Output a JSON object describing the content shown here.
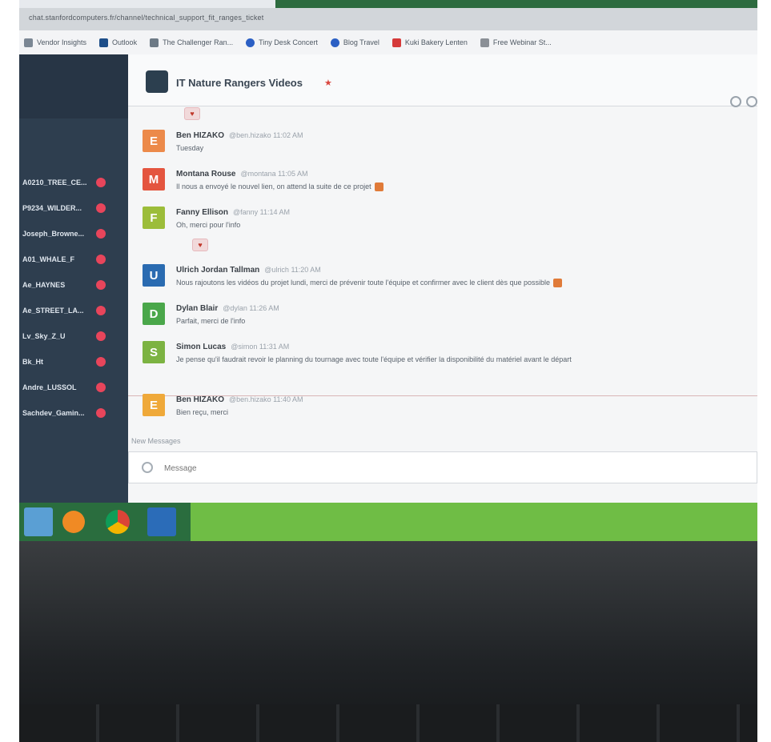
{
  "browser": {
    "url": "chat.stanfordcomputers.fr/channel/technical_support_fit_ranges_ticket"
  },
  "bookmarks": [
    {
      "label": "Vendor Insights",
      "color": "#7b8794"
    },
    {
      "label": "Outlook",
      "color": "#1d4e89"
    },
    {
      "label": "The Challenger Ran...",
      "color": "#6d7a86"
    },
    {
      "label": "Tiny Desk Concert",
      "color": "#2b5fc4"
    },
    {
      "label": "Blog Travel",
      "color": "#2b5fc4"
    },
    {
      "label": "Kuki Bakery Lenten",
      "color": "#d53a3a"
    },
    {
      "label": "Free Webinar St...",
      "color": "#8a8f96"
    }
  ],
  "sidebar": {
    "items": [
      {
        "label": "A0210_TREE_CE..."
      },
      {
        "label": "P9234_WILDER..."
      },
      {
        "label": "Joseph_Browne..."
      },
      {
        "label": "A01_WHALE_F"
      },
      {
        "label": "Ae_HAYNES"
      },
      {
        "label": "Ae_STREET_LA..."
      },
      {
        "label": "Lv_Sky_Z_U"
      },
      {
        "label": "Bk_Ht"
      },
      {
        "label": "Andre_LUSSOL"
      },
      {
        "label": "Sachdev_Gamin..."
      }
    ]
  },
  "channel": {
    "title": "IT Nature Rangers Videos",
    "star": "★"
  },
  "messages": [
    {
      "initial": "E",
      "color": "#ec8a4a",
      "author": "Ben HIZAKO",
      "meta": "@ben.hizako 11:02 AM",
      "text": "Tuesday"
    },
    {
      "initial": "M",
      "color": "#e4553f",
      "author": "Montana Rouse",
      "meta": "@montana 11:05 AM",
      "text": "Il nous a envoyé le nouvel lien, on attend la suite de ce projet"
    },
    {
      "initial": "F",
      "color": "#9cbd3a",
      "author": "Fanny Ellison",
      "meta": "@fanny 11:14 AM",
      "text": "Oh, merci pour l'info"
    },
    {
      "initial": "U",
      "color": "#2a6bb1",
      "author": "Ulrich Jordan Tallman",
      "meta": "@ulrich 11:20 AM",
      "text": "Nous rajoutons les vidéos du projet lundi, merci de prévenir toute l'équipe et confirmer avec le client dès que possible"
    },
    {
      "initial": "D",
      "color": "#4aa74a",
      "author": "Dylan Blair",
      "meta": "@dylan 11:26 AM",
      "text": "Parfait, merci de l'info"
    },
    {
      "initial": "S",
      "color": "#7cb342",
      "author": "Simon Lucas",
      "meta": "@simon 11:31 AM",
      "text": "Je pense qu'il faudrait revoir le planning du tournage avec toute l'équipe et vérifier la disponibilité du matériel avant le départ"
    },
    {
      "initial": "E",
      "color": "#efa93a",
      "author": "Ben HIZAKO",
      "meta": "@ben.hizako 11:40 AM",
      "text": "Bien reçu, merci"
    }
  ],
  "composer": {
    "hint": "New Messages",
    "placeholder": "Message"
  }
}
